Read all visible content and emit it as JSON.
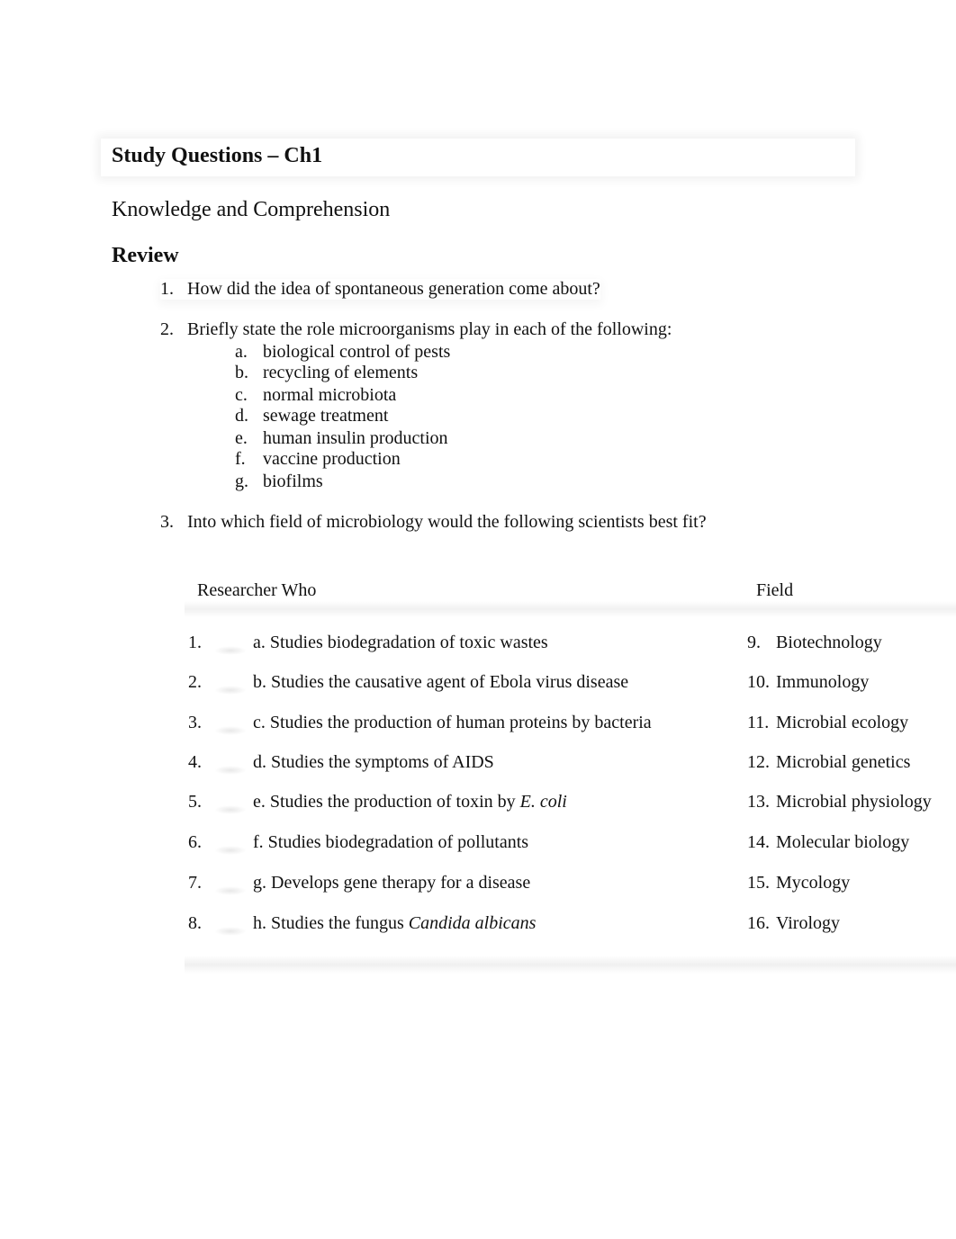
{
  "document": {
    "title": "Study Questions – Ch1",
    "section": "Knowledge and Comprehension",
    "subsection": "Review"
  },
  "questions": [
    {
      "num": "1.",
      "text": "How did the idea of spontaneous generation come about?"
    },
    {
      "num": "2.",
      "text": "Briefly state the role microorganisms play in each of the following:",
      "items": [
        {
          "label": "a.",
          "text": "biological control of pests"
        },
        {
          "label": "b.",
          "text": "recycling of elements"
        },
        {
          "label": "c.",
          "text": "normal microbiota"
        },
        {
          "label": "d.",
          "text": "sewage treatment"
        },
        {
          "label": "e.",
          "text": "human insulin production"
        },
        {
          "label": "f.",
          "text": "vaccine production"
        },
        {
          "label": "g.",
          "text": "biofilms"
        }
      ]
    },
    {
      "num": "3.",
      "text": "Into which field of microbiology would the following scientists best fit?"
    }
  ],
  "matching_table": {
    "headers": {
      "left": "Researcher Who",
      "right": "Field"
    },
    "rows": [
      {
        "num": "1.",
        "answer": "",
        "text": "a. Studies biodegradation of toxic wastes",
        "italic": "",
        "field_num": "9.",
        "field": "Biotechnology"
      },
      {
        "num": "2.",
        "answer": "",
        "text": "b. Studies the causative agent of Ebola virus disease",
        "italic": "",
        "field_num": "10.",
        "field": "Immunology"
      },
      {
        "num": "3.",
        "answer": "",
        "text": "c. Studies the production of human proteins by bacteria",
        "italic": "",
        "field_num": "11.",
        "field": "Microbial ecology"
      },
      {
        "num": "4.",
        "answer": "",
        "text": "d. Studies the symptoms of AIDS",
        "italic": "",
        "field_num": "12.",
        "field": "Microbial genetics"
      },
      {
        "num": "5.",
        "answer": "",
        "text": "e. Studies the production of toxin by ",
        "italic": "E. coli",
        "field_num": "13.",
        "field": "Microbial physiology"
      },
      {
        "num": "6.",
        "answer": "",
        "text": "f. Studies biodegradation of pollutants",
        "italic": "",
        "field_num": "14.",
        "field": "Molecular biology"
      },
      {
        "num": "7.",
        "answer": "",
        "text": "g. Develops gene therapy for a disease",
        "italic": "",
        "field_num": "15.",
        "field": "Mycology"
      },
      {
        "num": "8.",
        "answer": "",
        "text": "h. Studies the fungus ",
        "italic": "Candida albicans",
        "field_num": "16.",
        "field": "Virology"
      }
    ]
  }
}
